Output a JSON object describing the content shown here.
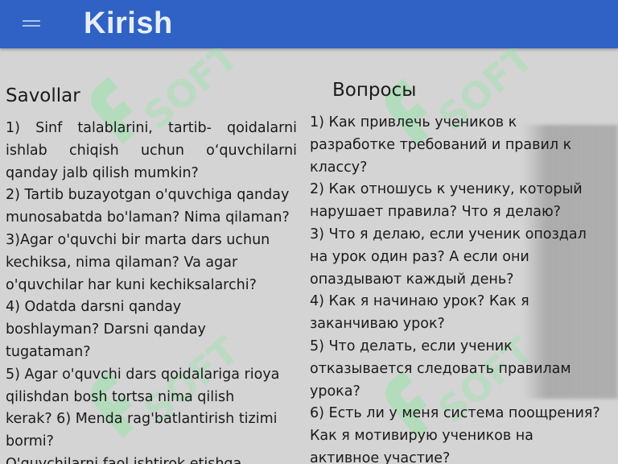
{
  "app_bar": {
    "title": "Kirish",
    "menu_icon": "hamburger-menu-icon",
    "color": "#2f62c4"
  },
  "watermark": {
    "text": "SOFT",
    "icon": "leaf-logo-icon",
    "color": "#8ce6a0"
  },
  "left_column": {
    "heading": "Savollar",
    "lines": [
      "1)  Sinf  talablarini,  tartib-  qoidalarni",
      "ishlab    chiqish  uchun  o‘quvchilarni",
      "qanday jalb  qilish mumkin?",
      "2) Tartib buzayotgan o'quvchiga qanday",
      "munosabatda bo'laman? Nima qilaman?",
      "3)Agar o'quvchi bir marta dars uchun",
      "kechiksa, nima qilaman? Va agar",
      "o'quvchilar  har kuni kechiksalarchi?",
      "4) Odatda darsni qanday",
      "boshlayman?  Darsni qanday",
      "tugataman?",
      "5) Agar o'quvchi dars qoidalariga rioya",
      "qilishdan bosh tortsa nima qilish",
      "kerak?  6) Menda rag'batlantirish tizimi",
      "bormi?",
      "O'quvchilarni faol ishtirok etishga"
    ]
  },
  "right_column": {
    "heading": "Вопросы",
    "lines": [
      "1) Как привлечь учеников к",
      "разработке  требований и правил к",
      "классу?",
      "2) Как отношусь к ученику, который",
      "нарушает правила? Что я делаю?",
      "3) Что я делаю, если ученик опоздал",
      "на  урок один раз? А если они",
      "опаздывают  каждый день?",
      "4) Как я начинаю урок? Как я",
      "заканчиваю урок?",
      "5) Что делать, если ученик",
      "отказывается  следовать правилам",
      "урока?",
      "6) Есть ли у меня система поощрения?",
      "Как я мотивирую учеников на",
      "активное  участие?"
    ]
  }
}
